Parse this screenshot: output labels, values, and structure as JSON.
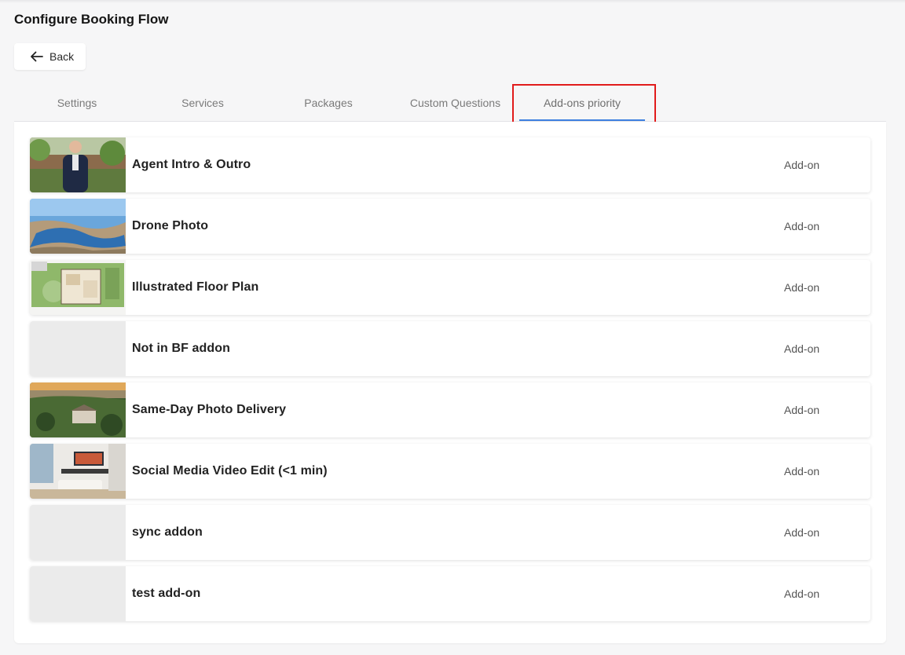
{
  "page": {
    "title": "Configure Booking Flow"
  },
  "back_button": {
    "label": "Back"
  },
  "tabs": [
    {
      "label": "Settings"
    },
    {
      "label": "Services"
    },
    {
      "label": "Packages"
    },
    {
      "label": "Custom Questions"
    },
    {
      "label": "Add-ons priority",
      "active": true
    }
  ],
  "accent_color": "#3d7fe0",
  "highlight_color": "#e11b1b",
  "addons": [
    {
      "name": "Agent Intro & Outro",
      "type": "Add-on",
      "image": "agent-presenter-photo"
    },
    {
      "name": "Drone Photo",
      "type": "Add-on",
      "image": "aerial-lake-photo"
    },
    {
      "name": "Illustrated Floor Plan",
      "type": "Add-on",
      "image": "site-plan-drawing"
    },
    {
      "name": "Not in BF addon",
      "type": "Add-on",
      "image": "placeholder"
    },
    {
      "name": "Same-Day Photo Delivery",
      "type": "Add-on",
      "image": "estate-sunset-photo"
    },
    {
      "name": "Social Media Video Edit (<1 min)",
      "type": "Add-on",
      "image": "living-room-photo"
    },
    {
      "name": "sync addon",
      "type": "Add-on",
      "image": "placeholder"
    },
    {
      "name": "test add-on",
      "type": "Add-on",
      "image": "placeholder"
    }
  ]
}
